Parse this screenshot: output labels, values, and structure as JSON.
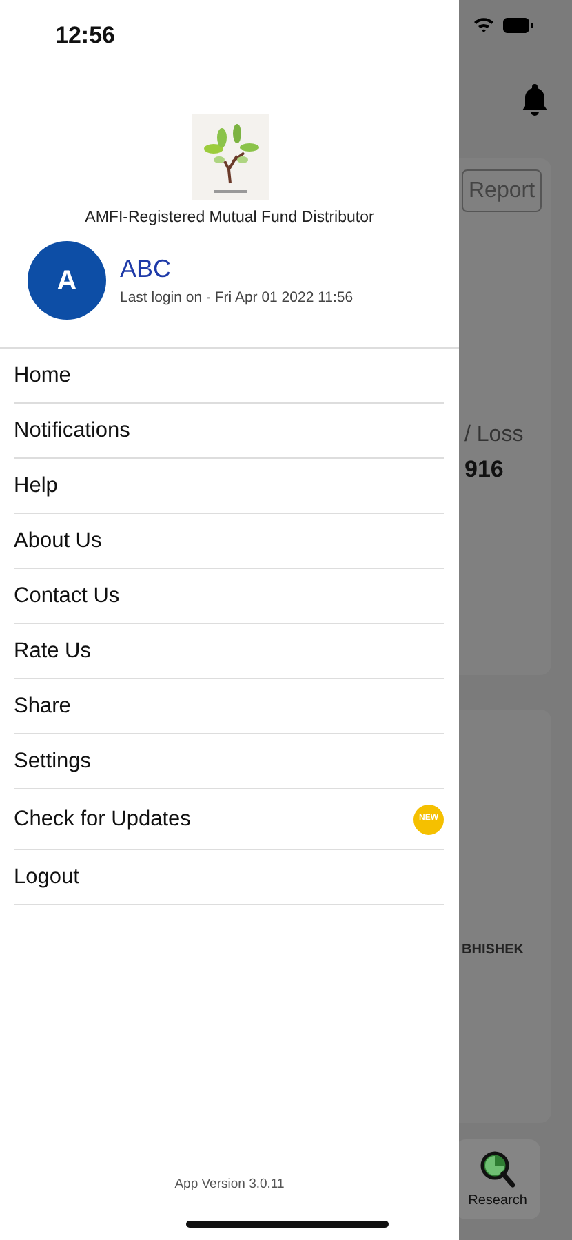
{
  "status_bar": {
    "time": "12:56"
  },
  "drawer": {
    "tagline": "AMFI-Registered Mutual Fund Distributor",
    "user": {
      "initial": "A",
      "name": "ABC",
      "last_login": "Last login on - Fri Apr 01 2022 11:56"
    },
    "menu": [
      {
        "label": "Home"
      },
      {
        "label": "Notifications"
      },
      {
        "label": "Help"
      },
      {
        "label": "About Us"
      },
      {
        "label": "Contact Us"
      },
      {
        "label": "Rate Us"
      },
      {
        "label": "Share"
      },
      {
        "label": "Settings"
      },
      {
        "label": "Check for Updates",
        "badge": "NEW"
      },
      {
        "label": "Logout"
      }
    ],
    "app_version": "App Version 3.0.11"
  },
  "background": {
    "report_button": "Report",
    "loss_label": "/ Loss",
    "loss_value": "916",
    "name": "BHISHEK",
    "tab": "Research"
  }
}
